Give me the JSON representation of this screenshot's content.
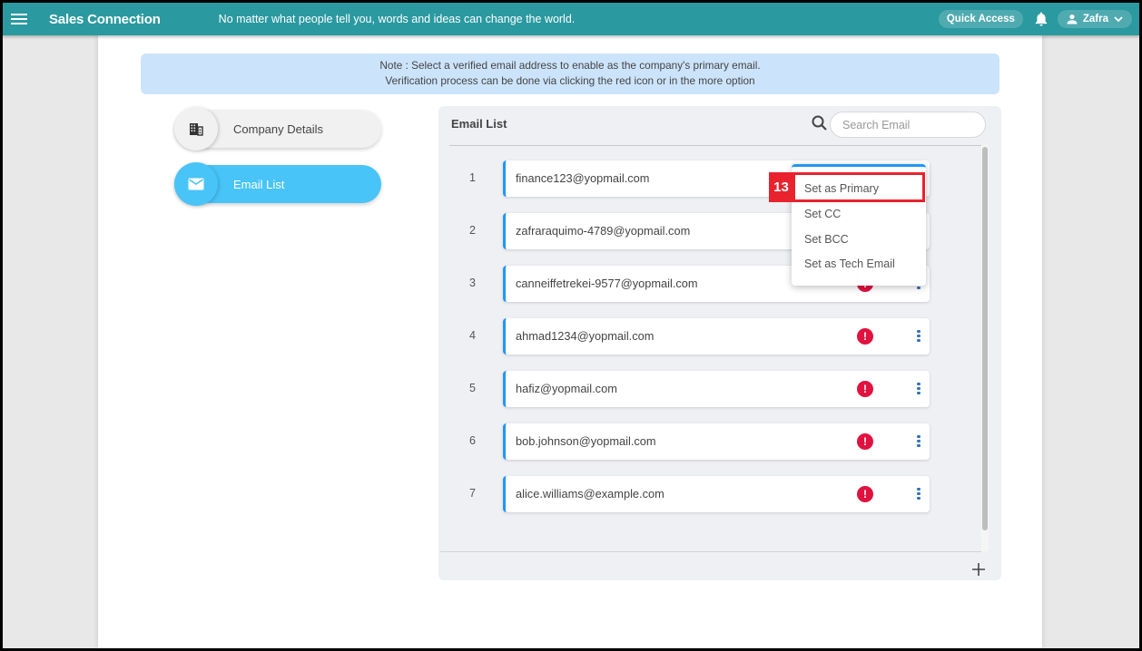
{
  "topbar": {
    "brand": "Sales Connection",
    "tagline": "No matter what people tell you, words and ideas can change the world.",
    "quick_access": "Quick Access",
    "user_name": "Zafra",
    "color": "#2a99a0"
  },
  "note": {
    "line1": "Note : Select a verified email address to enable as the company's primary email.",
    "line2": "Verification process can be done via clicking the red icon or in the more option"
  },
  "sidebar": {
    "items": [
      {
        "label": "Company Details",
        "icon": "building-icon",
        "active": false
      },
      {
        "label": "Email List",
        "icon": "envelope-icon",
        "active": true
      }
    ]
  },
  "email_panel": {
    "title": "Email List",
    "search_placeholder": "Search Email",
    "search_value": "",
    "rows": [
      {
        "num": "1",
        "email": "finance123@yopmail.com",
        "unverified": true
      },
      {
        "num": "2",
        "email": "zafraraquimo-4789@yopmail.com",
        "unverified": true
      },
      {
        "num": "3",
        "email": "canneiffetrekei-9577@yopmail.com",
        "unverified": true
      },
      {
        "num": "4",
        "email": "ahmad1234@yopmail.com",
        "unverified": true
      },
      {
        "num": "5",
        "email": "hafiz@yopmail.com",
        "unverified": true
      },
      {
        "num": "6",
        "email": "bob.johnson@yopmail.com",
        "unverified": true
      },
      {
        "num": "7",
        "email": "alice.williams@example.com",
        "unverified": true
      }
    ],
    "warn_glyph": "!",
    "add_glyph": "+"
  },
  "context_menu": {
    "items": [
      "Set as Primary",
      "Set CC",
      "Set BCC",
      "Set as Tech Email"
    ]
  },
  "annotation": {
    "step": "13",
    "color": "#e8232e"
  }
}
